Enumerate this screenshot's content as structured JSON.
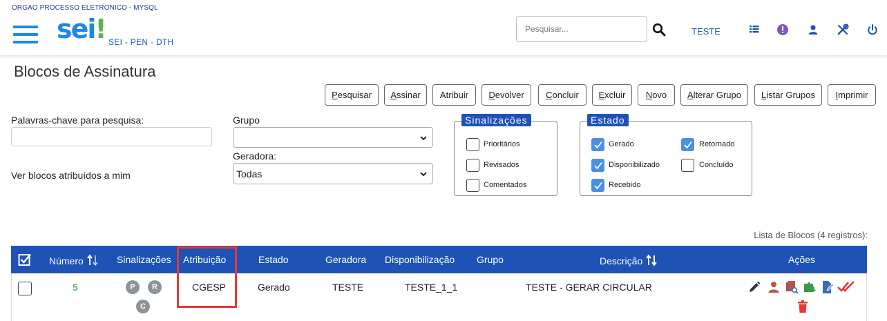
{
  "header": {
    "org": "ORGAO PROCESSO ELETRONICO - MYSQL",
    "logo": "sei",
    "logo_bang": "!",
    "subtitle": "SEI - PEN - DTH",
    "search_placeholder": "Pesquisar...",
    "user": "TESTE",
    "icons": [
      "menu-icon",
      "search-icon",
      "grid-icon",
      "alert-icon",
      "user-icon",
      "tools-icon",
      "power-icon"
    ]
  },
  "page": {
    "title": "Blocos de Assinatura"
  },
  "toolbar": [
    {
      "first": "P",
      "rest": "esquisar"
    },
    {
      "first": "A",
      "rest": "ssinar"
    },
    {
      "first": "",
      "rest": "Atribuir"
    },
    {
      "first": "D",
      "rest": "evolver"
    },
    {
      "first": "C",
      "rest": "oncluir"
    },
    {
      "first": "E",
      "rest": "xcluir"
    },
    {
      "first": "N",
      "rest": "ovo"
    },
    {
      "first": "A",
      "rest": "lterar Grupo"
    },
    {
      "first": "L",
      "rest": "istar Grupos"
    },
    {
      "first": "I",
      "rest": "mprimir"
    }
  ],
  "filters": {
    "keywords_label": "Palavras-chave para pesquisa:",
    "keywords_value": "",
    "assigned_to_me": "Ver blocos atribuídos a mim",
    "group_label": "Grupo",
    "group_value": "",
    "generator_label": "Geradora:",
    "generator_value": "Todas"
  },
  "sinalizacoes": {
    "legend": "Sinalizações",
    "options": [
      {
        "label": "Prioritários",
        "checked": false
      },
      {
        "label": "Revisados",
        "checked": false
      },
      {
        "label": "Comentados",
        "checked": false
      }
    ]
  },
  "estado": {
    "legend": "Estado",
    "options": [
      {
        "label": "Gerado",
        "checked": true
      },
      {
        "label": "Retornado",
        "checked": true
      },
      {
        "label": "Disponibilizado",
        "checked": true
      },
      {
        "label": "Concluído",
        "checked": false
      },
      {
        "label": "Recebido",
        "checked": true
      }
    ]
  },
  "table": {
    "caption": "Lista de Blocos (4 registros):",
    "columns": [
      "Número",
      "Sinalizações",
      "Atribuição",
      "Estado",
      "Geradora",
      "Disponibilização",
      "Grupo",
      "Descrição",
      "Ações"
    ],
    "rows": [
      {
        "numero": "5",
        "sinalizacoes": [
          "P",
          "R",
          "C"
        ],
        "atribuicao": "CGESP",
        "estado": "Gerado",
        "geradora": "TESTE",
        "disponibilizacao": "TESTE_1_1",
        "grupo": "",
        "descricao": "TESTE - GERAR CIRCULAR",
        "acoes": [
          "pen-icon",
          "user-assign-icon",
          "documents-search-icon",
          "puzzle-icon",
          "edit-document-icon",
          "double-check-icon",
          "trash-icon"
        ]
      }
    ]
  },
  "colors": {
    "brand_blue": "#1e52b7",
    "logo_blue": "#1e88e5",
    "logo_green": "#5db54a",
    "highlight": "#e53935"
  }
}
